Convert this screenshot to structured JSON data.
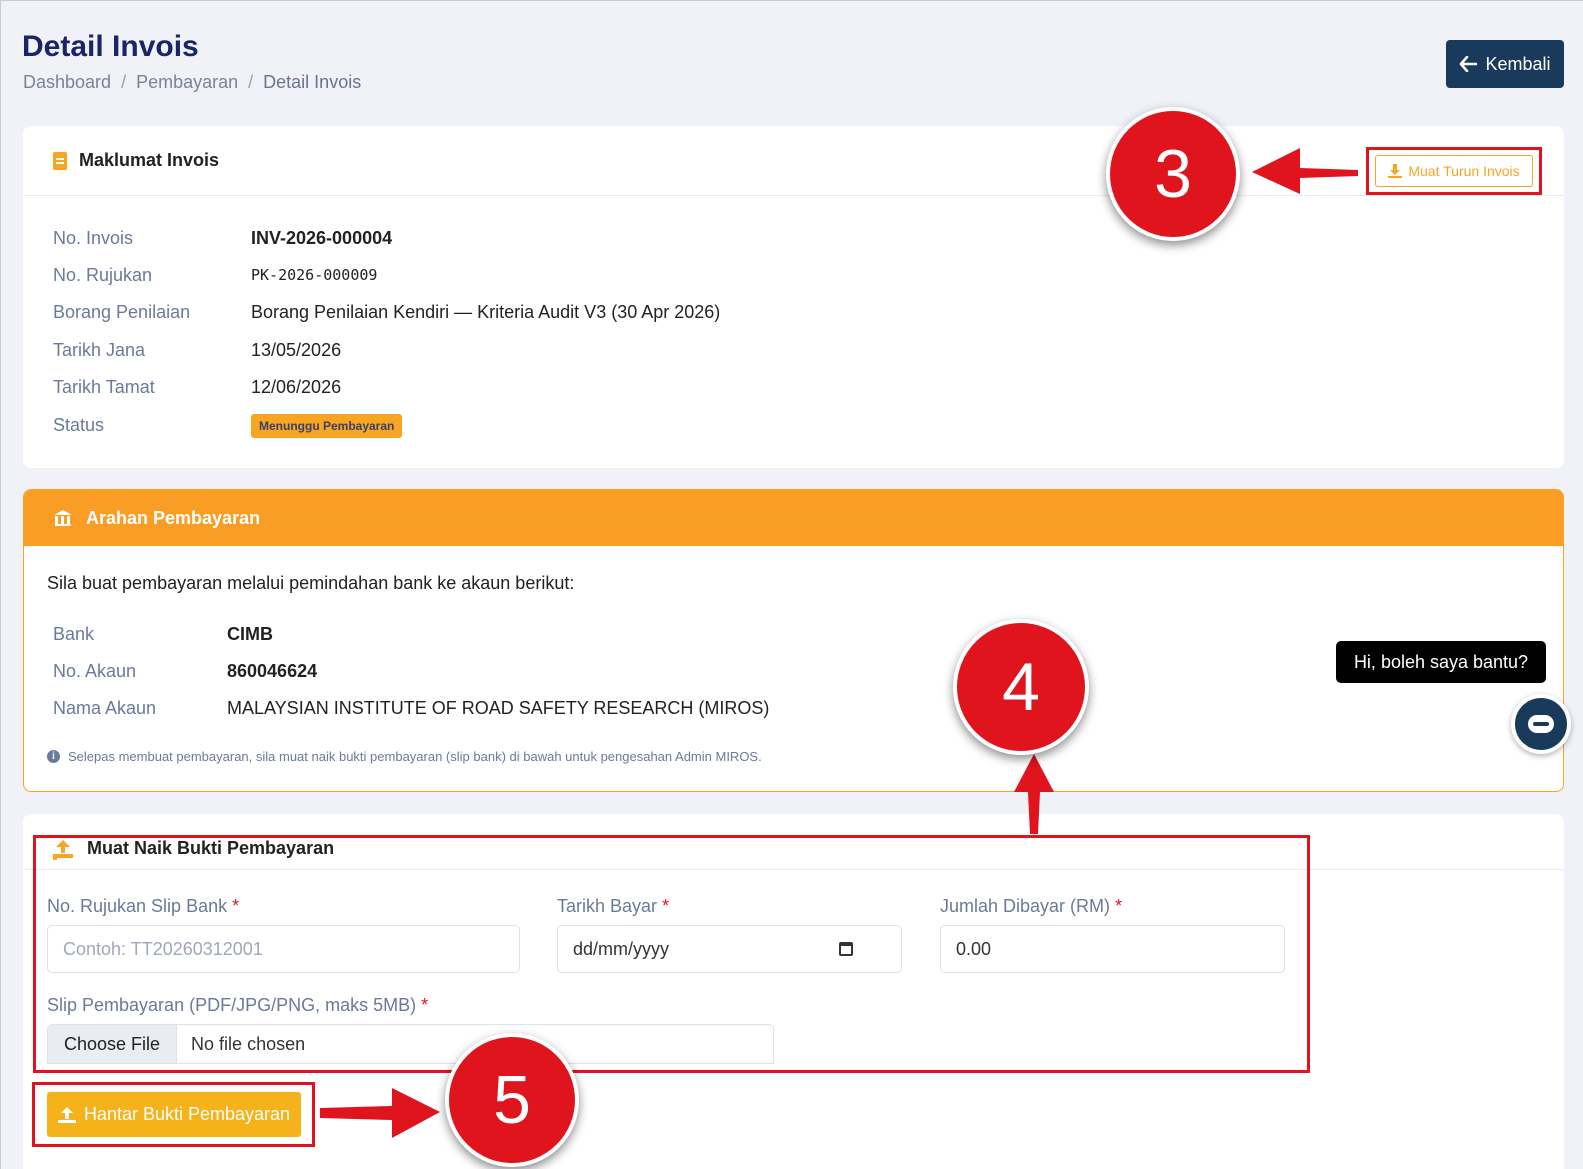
{
  "header": {
    "title": "Detail Invois",
    "breadcrumb": [
      "Dashboard",
      "Pembayaran",
      "Detail Invois"
    ],
    "back_label": "Kembali"
  },
  "invoice_card": {
    "title": "Maklumat Invois",
    "download_label": "Muat Turun Invois",
    "fields": [
      {
        "label": "No. Invois",
        "value": "INV-2026-000004"
      },
      {
        "label": "No. Rujukan",
        "value": "PK-2026-000009"
      },
      {
        "label": "Borang Penilaian",
        "value": "Borang Penilaian Kendiri — Kriteria Audit V3 (30 Apr 2026)"
      },
      {
        "label": "Tarikh Jana",
        "value": "13/05/2026"
      },
      {
        "label": "Tarikh Tamat",
        "value": "12/06/2026"
      },
      {
        "label": "Status",
        "value": "Menunggu Pembayaran"
      }
    ]
  },
  "payment_card": {
    "title": "Arahan Pembayaran",
    "intro": "Sila buat pembayaran melalui pemindahan bank ke akaun berikut:",
    "fields": [
      {
        "label": "Bank",
        "value": "CIMB"
      },
      {
        "label": "No. Akaun",
        "value": "860046624"
      },
      {
        "label": "Nama Akaun",
        "value": "MALAYSIAN INSTITUTE OF ROAD SAFETY RESEARCH (MIROS)"
      }
    ],
    "note": "Selepas membuat pembayaran, sila muat naik bukti pembayaran (slip bank) di bawah untuk pengesahan Admin MIROS."
  },
  "upload_card": {
    "title": "Muat Naik Bukti Pembayaran",
    "ref_label": "No. Rujukan Slip Bank",
    "ref_placeholder": "Contoh: TT20260312001",
    "date_label": "Tarikh Bayar",
    "date_value": "dd/mm/yyyy",
    "amount_label": "Jumlah Dibayar (RM)",
    "amount_value": "0.00",
    "slip_label": "Slip Pembayaran (PDF/JPG/PNG, maks 5MB)",
    "choose_label": "Choose File",
    "no_file": "No file chosen",
    "required_mark": "*",
    "submit_label": "Hantar Bukti Pembayaran"
  },
  "annotations": {
    "step3": "3",
    "step4": "4",
    "step5": "5"
  },
  "chat": {
    "tooltip": "Hi, boleh saya bantu?"
  },
  "colors": {
    "accent": "#f6a623",
    "navy": "#1a3a5c",
    "annotation_red": "#e0141c"
  }
}
